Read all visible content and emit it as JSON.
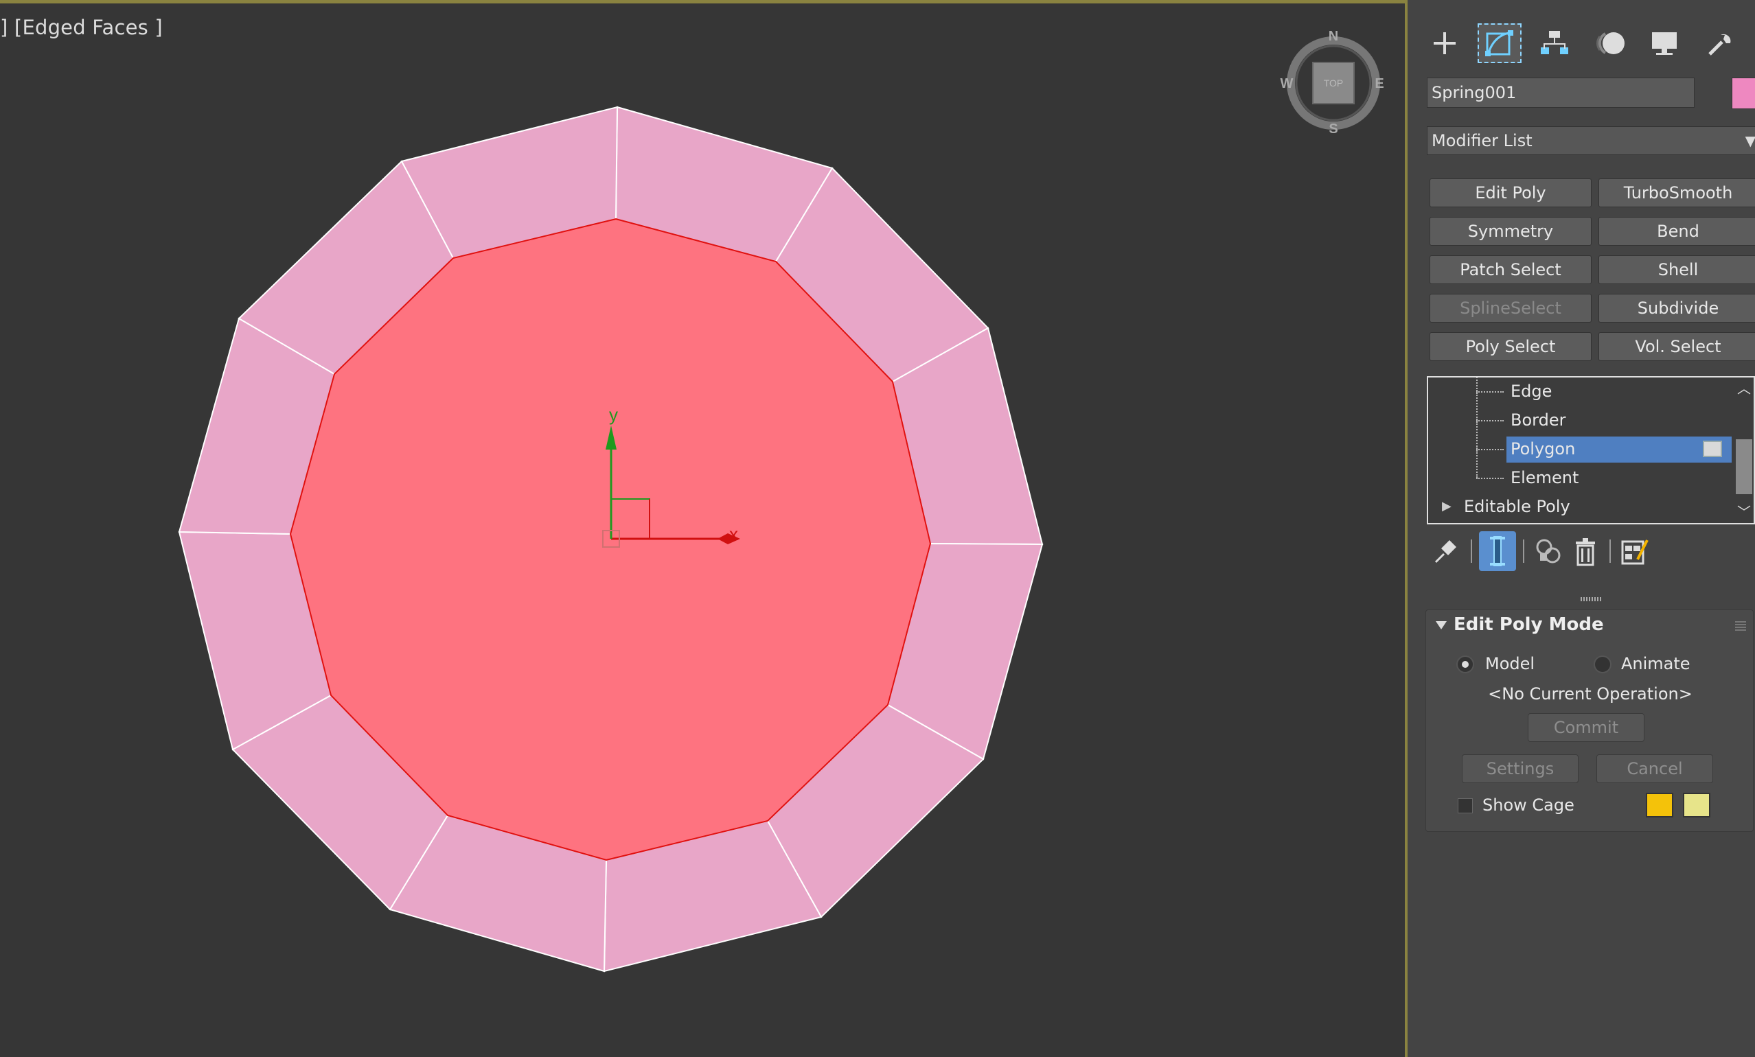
{
  "viewport": {
    "label": "] [Edged Faces ]",
    "viewcube": {
      "n": "N",
      "s": "S",
      "e": "E",
      "w": "W",
      "face": "TOP"
    },
    "gizmo": {
      "x_label": "x",
      "y_label": "y"
    },
    "colors": {
      "outer_faces": "#e8a6c8",
      "selected_faces": "#fe7380",
      "background": "#363636"
    }
  },
  "panel": {
    "tabs": [
      {
        "name": "create",
        "icon": "plus-icon"
      },
      {
        "name": "modify",
        "icon": "modify-icon"
      },
      {
        "name": "hierarchy",
        "icon": "hierarchy-icon"
      },
      {
        "name": "motion",
        "icon": "motion-icon"
      },
      {
        "name": "display",
        "icon": "display-icon"
      },
      {
        "name": "utilities",
        "icon": "wrench-icon"
      }
    ],
    "object_name": "Spring001",
    "object_color": "#ee88c0",
    "modifier_list": "Modifier List",
    "modifier_buttons": [
      {
        "label": "Edit Poly",
        "enabled": true
      },
      {
        "label": "TurboSmooth",
        "enabled": true
      },
      {
        "label": "Symmetry",
        "enabled": true
      },
      {
        "label": "Bend",
        "enabled": true
      },
      {
        "label": "Patch Select",
        "enabled": true
      },
      {
        "label": "Shell",
        "enabled": true
      },
      {
        "label": "SplineSelect",
        "enabled": false
      },
      {
        "label": "Subdivide",
        "enabled": true
      },
      {
        "label": "Poly Select",
        "enabled": true
      },
      {
        "label": "Vol. Select",
        "enabled": true
      }
    ],
    "stack": {
      "items": [
        "Edge",
        "Border",
        "Polygon",
        "Element"
      ],
      "selected": "Polygon",
      "base": "Editable Poly"
    },
    "rollout": {
      "title": "Edit Poly Mode",
      "model_label": "Model",
      "animate_label": "Animate",
      "operation": "<No Current Operation>",
      "commit": "Commit",
      "settings": "Settings",
      "cancel": "Cancel",
      "show_cage": "Show Cage",
      "cage_colors": [
        "#f4c20a",
        "#e7e48a"
      ]
    }
  }
}
